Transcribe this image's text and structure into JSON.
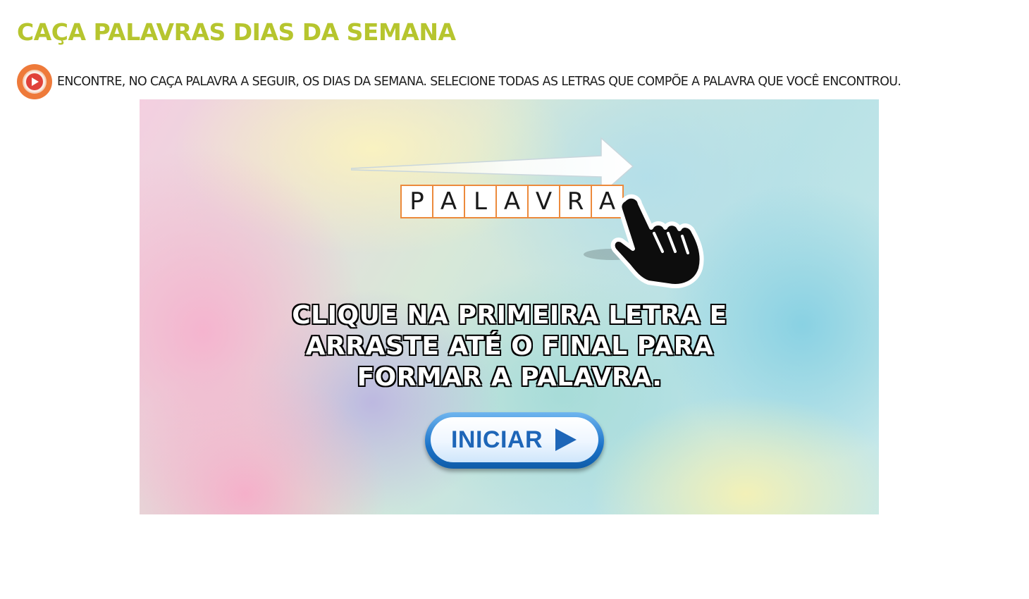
{
  "page": {
    "title": "CAÇA PALAVRAS DIAS DA SEMANA",
    "instruction": "ENCONTRE, NO CAÇA PALAVRA A SEGUIR, OS DIAS DA SEMANA. SELECIONE TODAS AS LETRAS QUE COMPÕE A PALAVRA QUE VOCÊ ENCONTROU.",
    "audio_icon": "play-audio-icon"
  },
  "game": {
    "word_tiles": [
      "P",
      "A",
      "L",
      "A",
      "V",
      "R",
      "A"
    ],
    "instruction_lines": [
      "CLIQUE NA PRIMEIRA LETRA E",
      "ARRASTE ATÉ O FINAL PARA",
      "FORMAR A PALAVRA."
    ],
    "start_label": "INICIAR",
    "start_icon": "play-triangle-icon",
    "hand_icon": "pointing-hand-icon",
    "arrow_icon": "right-arrow-icon"
  },
  "colors": {
    "title": "#b6c52e",
    "tile_border": "#ec8a3c",
    "button_blue": "#1e66b8",
    "audio_orange": "#ee7a3a"
  }
}
